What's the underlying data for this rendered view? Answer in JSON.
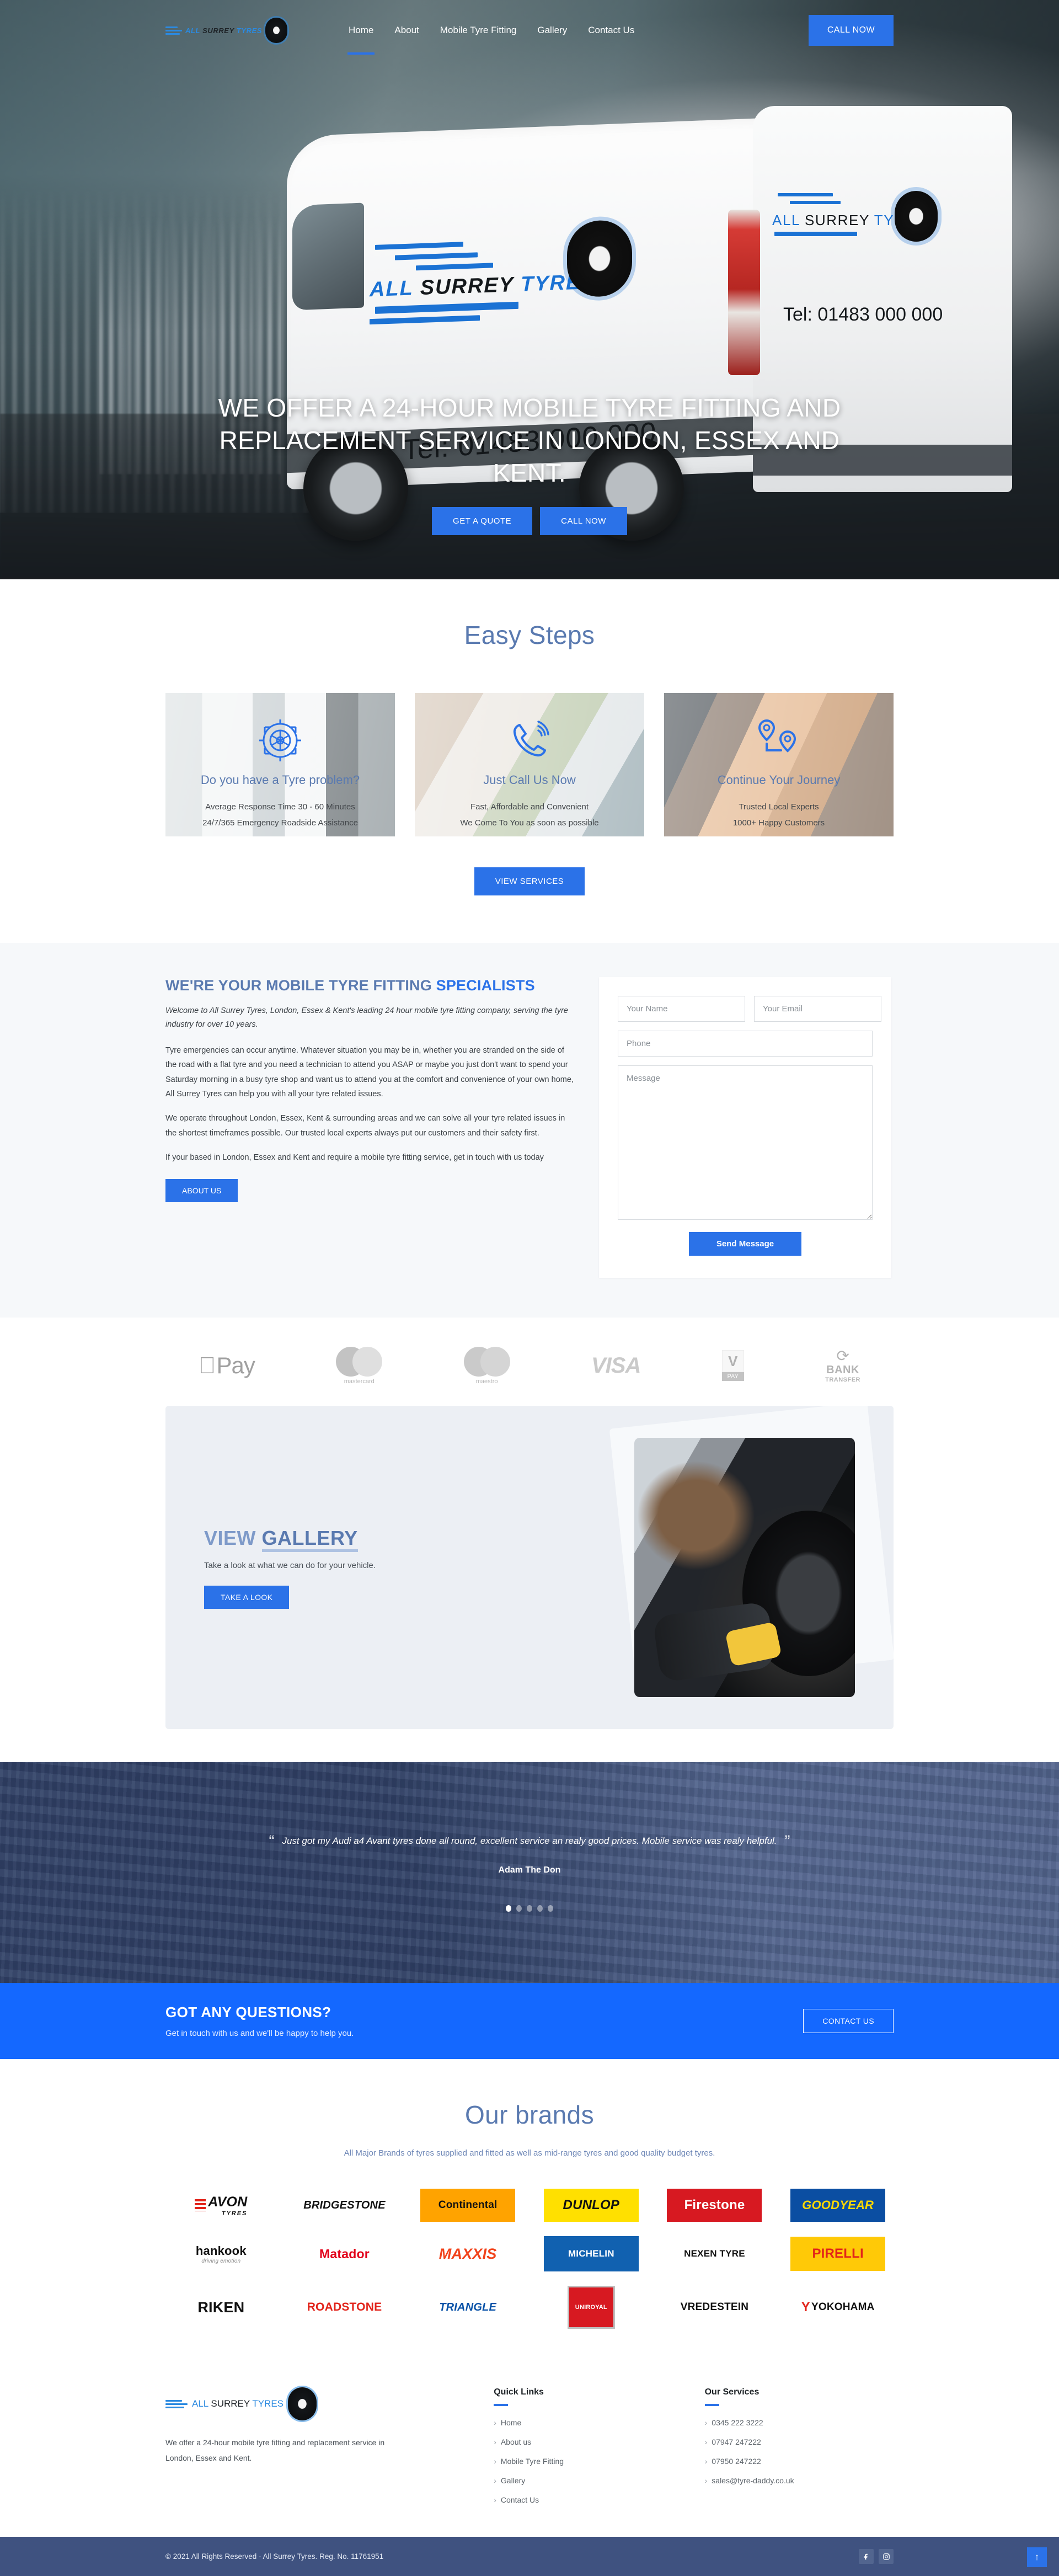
{
  "brand": {
    "all": "ALL",
    "surrey": "SURREY",
    "tyres": "TYRES"
  },
  "nav": {
    "items": [
      {
        "label": "Home",
        "active": true
      },
      {
        "label": "About",
        "active": false
      },
      {
        "label": "Mobile Tyre Fitting",
        "active": false
      },
      {
        "label": "Gallery",
        "active": false
      },
      {
        "label": "Contact Us",
        "active": false
      }
    ],
    "cta": "CALL NOW"
  },
  "hero": {
    "title": "WE OFFER A 24-HOUR MOBILE TYRE FITTING AND REPLACEMENT SERVICE IN LONDON, ESSEX AND KENT.",
    "btn_quote": "GET A QUOTE",
    "btn_call": "CALL NOW",
    "van_logo_all": "ALL",
    "van_logo_surrey": "SURREY",
    "van_logo_tyres": "TYRES",
    "van_tel": "Tel: 01483 000 000",
    "van_rear_tel": "Tel: 01483 000 000"
  },
  "steps": {
    "title": "Easy Steps",
    "cards": [
      {
        "icon": "tyre-target-icon",
        "heading": "Do you have a Tyre problem?",
        "line1": "Average Response Time 30 - 60 Minutes",
        "line2": "24/7/365 Emergency Roadside Assistance"
      },
      {
        "icon": "phone-ringing-icon",
        "heading": "Just Call Us Now",
        "line1": "Fast, Affordable and Convenient",
        "line2": "We Come To You as soon as possible"
      },
      {
        "icon": "route-pin-icon",
        "heading": "Continue Your Journey",
        "line1": "Trusted Local Experts",
        "line2": "1000+ Happy Customers"
      }
    ],
    "view_services": "VIEW SERVICES"
  },
  "about": {
    "heading_main": "WE'RE YOUR MOBILE TYRE FITTING ",
    "heading_hl": "SPECIALISTS",
    "lead": "Welcome to All Surrey Tyres, London, Essex & Kent's leading 24 hour mobile tyre fitting company, serving the tyre industry for over 10 years.",
    "p1": "Tyre emergencies can occur anytime. Whatever situation you may be in, whether you are stranded on the side of the road with a flat tyre and you need a technician to attend you ASAP or maybe you just don't want to spend your Saturday morning in a busy tyre shop and want us to attend you at the comfort and convenience of your own home, All Surrey Tyres can help you with all your tyre related issues.",
    "p2": "We operate throughout London, Essex, Kent & surrounding areas and we can solve all your tyre related issues in the shortest timeframes possible. Our trusted local experts always put our customers and their safety first.",
    "p3": "If your based in London, Essex and Kent and require a mobile tyre fitting service, get in touch with us today",
    "btn": "ABOUT US"
  },
  "form": {
    "name_placeholder": "Your Name",
    "email_placeholder": "Your Email",
    "phone_placeholder": "Phone",
    "message_placeholder": "Message",
    "submit": "Send Message",
    "name_value": "",
    "email_value": "",
    "phone_value": "",
    "message_value": ""
  },
  "payments": [
    {
      "name": "apple-pay",
      "label": "Pay"
    },
    {
      "name": "mastercard",
      "label": "mastercard"
    },
    {
      "name": "maestro",
      "label": "maestro"
    },
    {
      "name": "visa",
      "label": "VISA"
    },
    {
      "name": "v-pay",
      "label": "PAY",
      "mark": "V"
    },
    {
      "name": "bank-transfer",
      "label1": "BANK",
      "label2": "TRANSFER"
    }
  ],
  "gallery": {
    "heading_a": "VIEW ",
    "heading_b": "GALLERY",
    "text": "Take a look at what we can do for your vehicle.",
    "btn": "TAKE A LOOK"
  },
  "testimonial": {
    "quote": "Just got my Audi a4 Avant tyres done all round, excellent service an realy good prices. Mobile service was realy helpful.",
    "author": "Adam The Don",
    "dots": 5,
    "active_dot": 0
  },
  "questions": {
    "heading": "GOT ANY QUESTIONS?",
    "sub": "Get in touch with us and we'll be happy to help you.",
    "btn": "CONTACT US"
  },
  "brands": {
    "title": "Our brands",
    "subtitle": "All Major Brands of tyres supplied and fitted as well as mid-range tyres and good quality budget tyres.",
    "items": [
      {
        "name": "AVON",
        "sub": "TYRES",
        "key": "avon"
      },
      {
        "name": "BRIDGESTONE",
        "key": "bridgestone"
      },
      {
        "name": "Continental",
        "key": "continental"
      },
      {
        "name": "DUNLOP",
        "key": "dunlop"
      },
      {
        "name": "Firestone",
        "key": "firestone"
      },
      {
        "name": "GOODYEAR",
        "key": "goodyear"
      },
      {
        "name": "hankook",
        "sub": "driving emotion",
        "key": "hankook"
      },
      {
        "name": "Matador",
        "key": "matador"
      },
      {
        "name": "MAXXIS",
        "key": "maxxis"
      },
      {
        "name": "MICHELIN",
        "key": "michelin"
      },
      {
        "name": "NEXEN TYRE",
        "key": "nexen"
      },
      {
        "name": "PIRELLI",
        "key": "pirelli"
      },
      {
        "name": "RIKEN",
        "key": "riken"
      },
      {
        "name": "ROADSTONE",
        "key": "roadstone"
      },
      {
        "name": "TRIANGLE",
        "key": "triangle"
      },
      {
        "name": "UNIROYAL",
        "key": "uniroyal"
      },
      {
        "name": "VREDESTEIN",
        "key": "vredestein"
      },
      {
        "name": "YOKOHAMA",
        "key": "yokohama"
      }
    ]
  },
  "footer": {
    "about": "We offer a 24-hour mobile tyre fitting and replacement service in London, Essex and Kent.",
    "quick_links_title": "Quick Links",
    "quick_links": [
      "Home",
      "About us",
      "Mobile Tyre Fitting",
      "Gallery",
      "Contact Us"
    ],
    "services_title": "Our Services",
    "services": [
      "0345 222 3222",
      "07947 247222",
      "07950 247222",
      "sales@tyre-daddy.co.uk"
    ],
    "copyright": "© 2021 All Rights Reserved - All Surrey Tyres. Reg. No. 11761951",
    "social": [
      "facebook-icon",
      "instagram-icon"
    ],
    "to_top": "↑"
  },
  "colors": {
    "accent": "#2b72e8",
    "band": "#1468ff",
    "heading": "#5a7ab0",
    "footer_bar": "#3f5280"
  }
}
